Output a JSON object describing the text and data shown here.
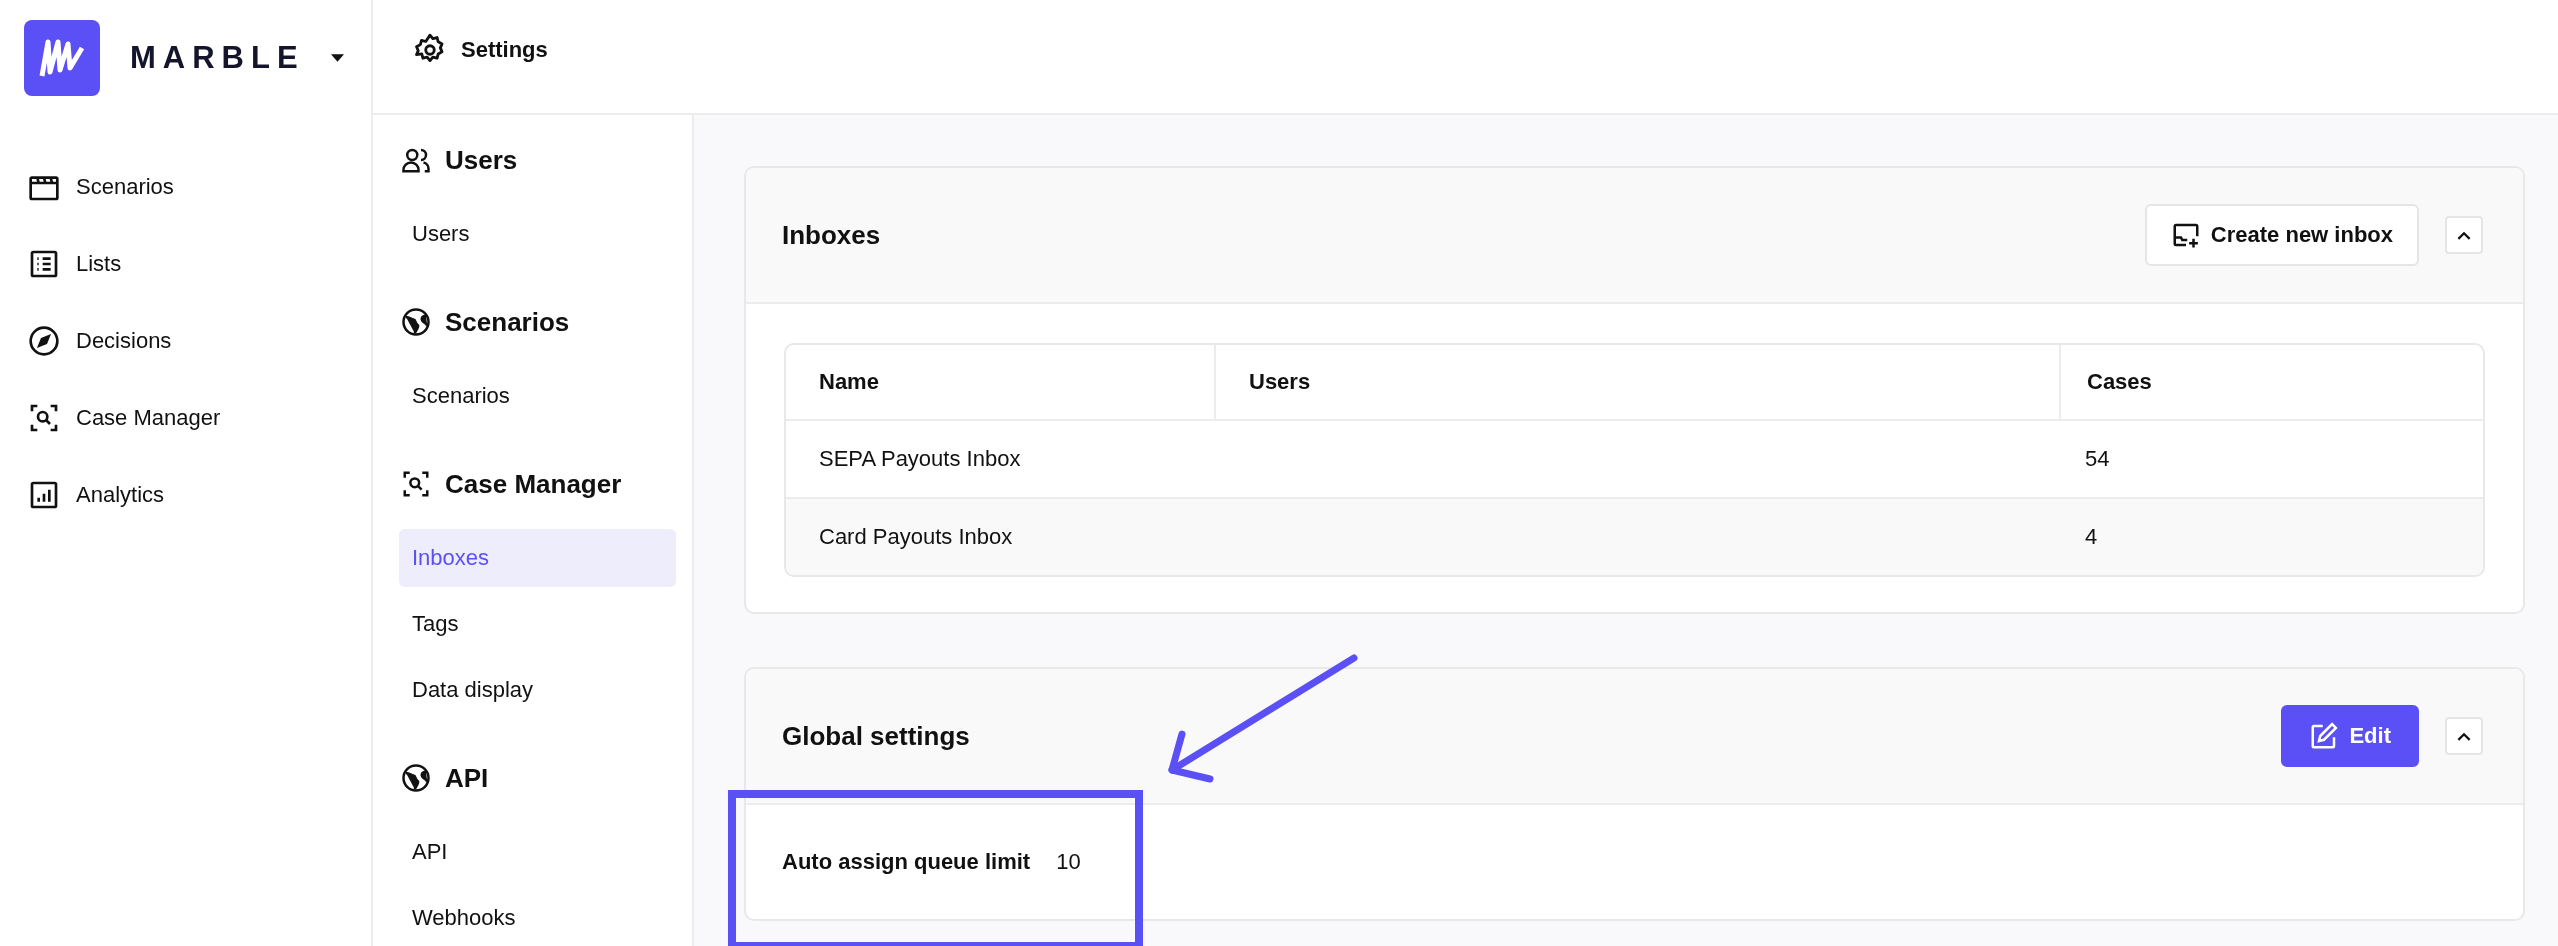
{
  "brand": {
    "name": "MARBLE"
  },
  "nav": [
    {
      "label": "Scenarios",
      "selected": false
    },
    {
      "label": "Lists",
      "selected": false
    },
    {
      "label": "Decisions",
      "selected": false
    },
    {
      "label": "Case Manager",
      "selected": false
    },
    {
      "label": "Analytics",
      "selected": false
    }
  ],
  "header": {
    "title": "Settings"
  },
  "settings_nav": [
    {
      "title": "Users",
      "items": [
        {
          "label": "Users",
          "selected": false
        }
      ]
    },
    {
      "title": "Scenarios",
      "items": [
        {
          "label": "Scenarios",
          "selected": false
        }
      ]
    },
    {
      "title": "Case Manager",
      "items": [
        {
          "label": "Inboxes",
          "selected": true
        },
        {
          "label": "Tags",
          "selected": false
        },
        {
          "label": "Data display",
          "selected": false
        }
      ]
    },
    {
      "title": "API",
      "items": [
        {
          "label": "API",
          "selected": false
        },
        {
          "label": "Webhooks",
          "selected": false
        }
      ]
    }
  ],
  "inboxes": {
    "title": "Inboxes",
    "create_button": "Create new inbox",
    "expanded": true,
    "table": {
      "columns": [
        "Name",
        "Users",
        "Cases"
      ],
      "rows": [
        [
          "SEPA Payouts Inbox",
          "",
          "54"
        ],
        [
          "Card Payouts Inbox",
          "",
          "4"
        ]
      ]
    }
  },
  "global_settings": {
    "title": "Global settings",
    "edit_button": "Edit",
    "expanded": true,
    "settings": [
      {
        "label": "Auto assign queue limit",
        "value": "10"
      }
    ]
  }
}
